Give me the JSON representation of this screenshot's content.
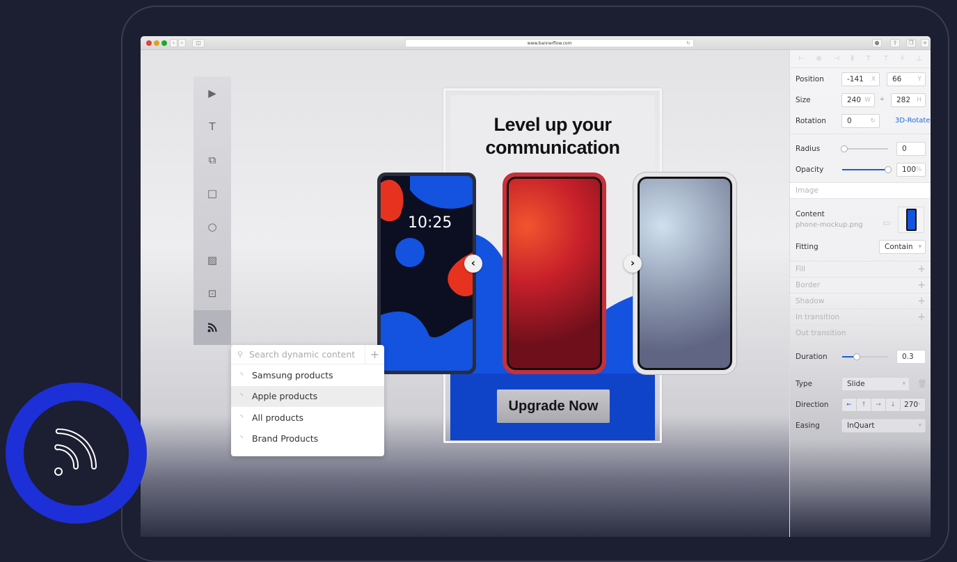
{
  "browser": {
    "url": "www.bannerflow.com",
    "traffic_lights": [
      "#e0443e",
      "#dea123",
      "#1aab29"
    ],
    "nav_back": "‹",
    "nav_forward": "›"
  },
  "tools": [
    {
      "name": "select",
      "glyph": "▶"
    },
    {
      "name": "text",
      "glyph": "T"
    },
    {
      "name": "widget",
      "glyph": "⧉"
    },
    {
      "name": "rectangle",
      "glyph": "□"
    },
    {
      "name": "ellipse",
      "glyph": "○"
    },
    {
      "name": "image",
      "glyph": "▨"
    },
    {
      "name": "dynamic-image",
      "glyph": "⊡"
    },
    {
      "name": "dynamic-content",
      "glyph": "⌇",
      "active": true
    }
  ],
  "dynamic_dropdown": {
    "search_placeholder": "Search dynamic content",
    "add": "+",
    "items": [
      "Samsung products",
      "Apple products",
      "All products",
      "Brand Products"
    ],
    "selected_index": 1
  },
  "banner": {
    "headline_line1": "Level up your",
    "headline_line2": "communication",
    "cta": "Upgrade Now",
    "phone_time": "10:25",
    "prev": "‹",
    "next": "›"
  },
  "properties": {
    "position": {
      "label": "Position",
      "x": "-141",
      "y": "66",
      "x_suffix": "X",
      "y_suffix": "Y"
    },
    "size": {
      "label": "Size",
      "w": "240",
      "h": "282",
      "w_suffix": "W",
      "h_suffix": "H"
    },
    "rotation": {
      "label": "Rotation",
      "value": "0",
      "link": "3D-Rotate"
    },
    "radius": {
      "label": "Radius",
      "value": "0",
      "slider": 0
    },
    "opacity": {
      "label": "Opacity",
      "value": "100",
      "suffix": "%",
      "slider": 1.0
    },
    "image_section": "Image",
    "content": {
      "label": "Content",
      "file": "phone-mockup.png"
    },
    "fitting": {
      "label": "Fitting",
      "value": "Contain"
    },
    "sections": [
      "Fill",
      "Border",
      "Shadow",
      "In transition",
      "Out transition"
    ],
    "duration": {
      "label": "Duration",
      "value": "0.3",
      "slider": 0.3
    },
    "type": {
      "label": "Type",
      "value": "Slide"
    },
    "direction": {
      "label": "Direction",
      "arrows": [
        "←",
        "↑",
        "→",
        "↓"
      ],
      "value": "270",
      "suffix": "°"
    },
    "easing": {
      "label": "Easing",
      "value": "InQuart"
    }
  },
  "colors": {
    "accent": "#1e5ad6",
    "badge": "#1d2fd6",
    "background": "#1c1e31"
  }
}
